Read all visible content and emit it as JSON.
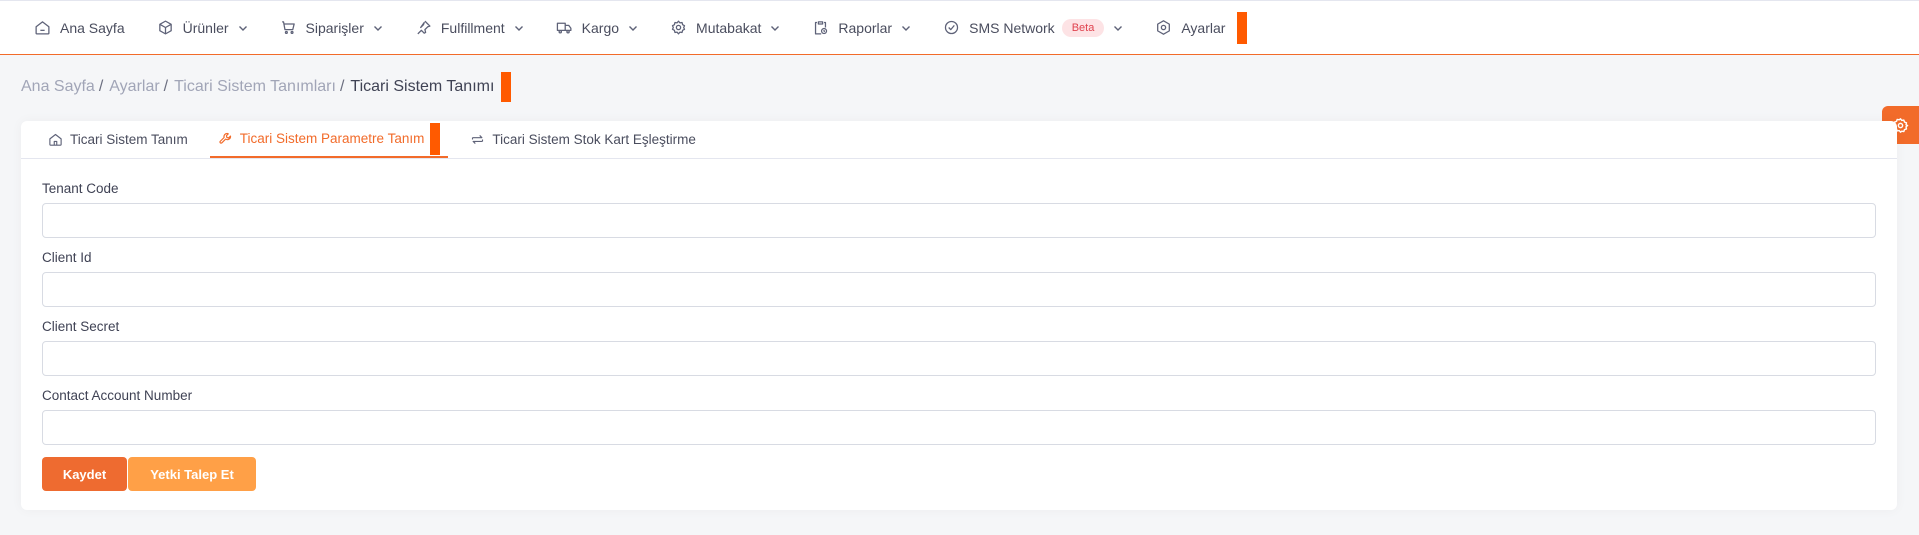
{
  "nav": {
    "items": [
      {
        "label": "Ana Sayfa",
        "icon": "home-icon",
        "dropdown": false
      },
      {
        "label": "Ürünler",
        "icon": "box-icon",
        "dropdown": true
      },
      {
        "label": "Siparişler",
        "icon": "cart-icon",
        "dropdown": true
      },
      {
        "label": "Fulfillment",
        "icon": "pin-icon",
        "dropdown": true
      },
      {
        "label": "Kargo",
        "icon": "truck-icon",
        "dropdown": true
      },
      {
        "label": "Mutabakat",
        "icon": "eye-gear-icon",
        "dropdown": true
      },
      {
        "label": "Raporlar",
        "icon": "clipboard-icon",
        "dropdown": true
      },
      {
        "label": "SMS Network",
        "icon": "check-circle-icon",
        "dropdown": true,
        "badge": "Beta"
      },
      {
        "label": "Ayarlar",
        "icon": "hexagon-gear-icon",
        "dropdown": false
      }
    ]
  },
  "breadcrumb": {
    "items": [
      "Ana Sayfa",
      "Ayarlar",
      "Ticari Sistem Tanımları"
    ],
    "separator": "/",
    "current": "Ticari Sistem Tanımı"
  },
  "tabs": [
    {
      "label": "Ticari Sistem Tanım",
      "icon": "home-icon",
      "active": false
    },
    {
      "label": "Ticari Sistem Parametre Tanım",
      "icon": "wrench-icon",
      "active": true
    },
    {
      "label": "Ticari Sistem Stok Kart Eşleştirme",
      "icon": "swap-icon",
      "active": false
    }
  ],
  "form": {
    "fields": [
      {
        "label": "Tenant Code",
        "value": ""
      },
      {
        "label": "Client Id",
        "value": ""
      },
      {
        "label": "Client Secret",
        "value": ""
      },
      {
        "label": "Contact Account Number",
        "value": ""
      }
    ],
    "save_label": "Kaydet",
    "request_label": "Yetki Talep Et"
  },
  "colors": {
    "accent": "#f26b2a",
    "marker": "#ff5a00",
    "primary_button": "#ee6b30",
    "secondary_button": "#ffa047",
    "badge_bg": "#fde3e5",
    "badge_text": "#e0434f"
  }
}
